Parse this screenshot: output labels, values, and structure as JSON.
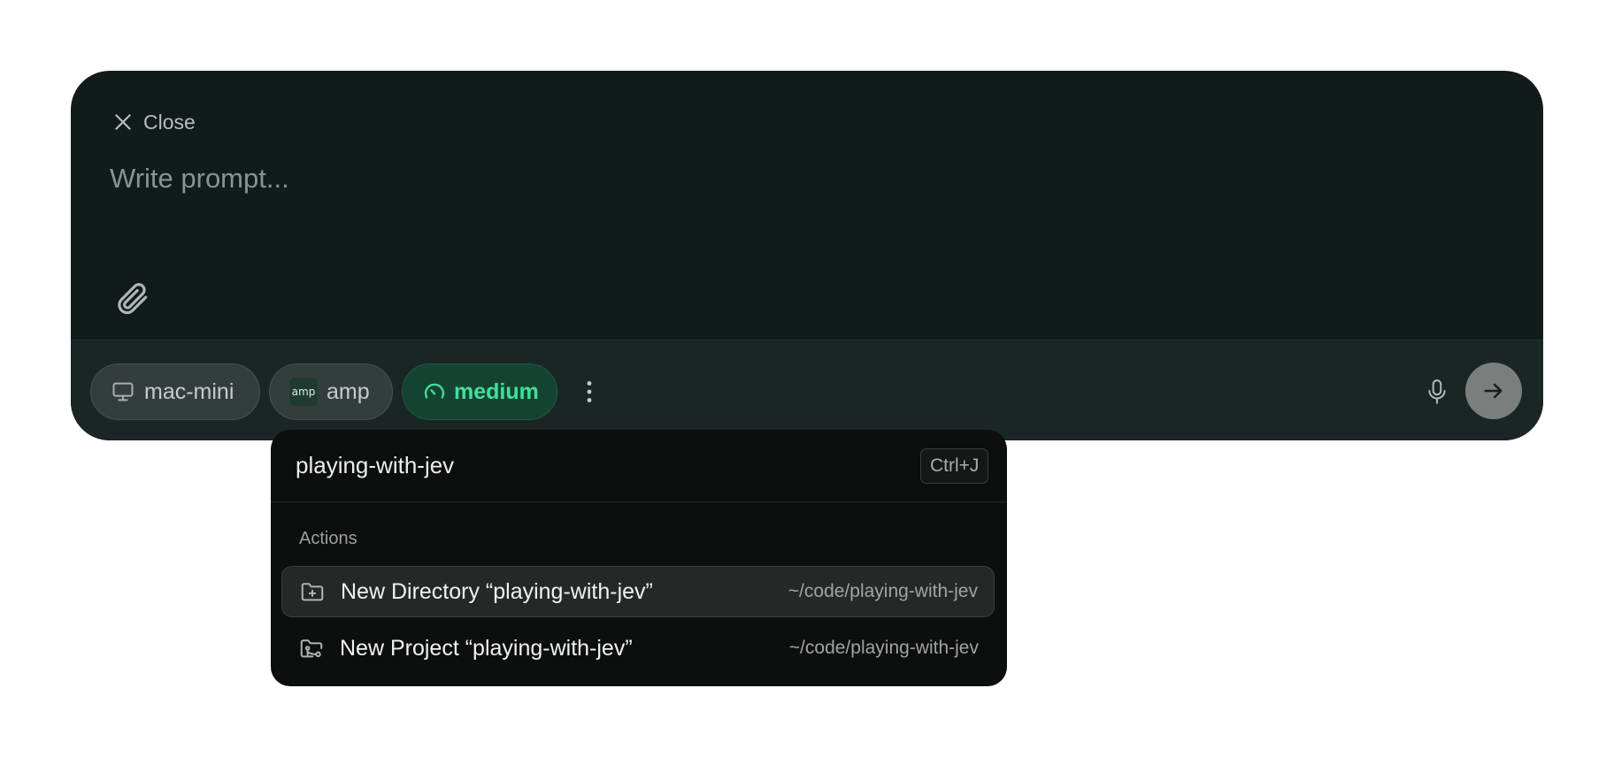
{
  "composer": {
    "close_label": "Close",
    "prompt_placeholder": "Write prompt...",
    "prompt_value": ""
  },
  "toolbar": {
    "device_label": "mac-mini",
    "agent_label": "amp",
    "agent_logo_text": "amp",
    "effort_label": "medium"
  },
  "dropdown": {
    "search_value": "playing-with-jev",
    "shortcut": "Ctrl+J",
    "section_label": "Actions",
    "items": [
      {
        "label": "New Directory “playing-with-jev”",
        "path": "~/code/playing-with-jev",
        "icon": "folder-plus-icon",
        "selected": true
      },
      {
        "label": "New Project “playing-with-jev”",
        "path": "~/code/playing-with-jev",
        "icon": "folder-git-icon",
        "selected": false
      }
    ]
  },
  "colors": {
    "panel_bg": "#121b1c",
    "toolbar_bg": "#1a2526",
    "effort_accent": "#43e09a",
    "dropdown_bg": "#0d0f0e"
  }
}
